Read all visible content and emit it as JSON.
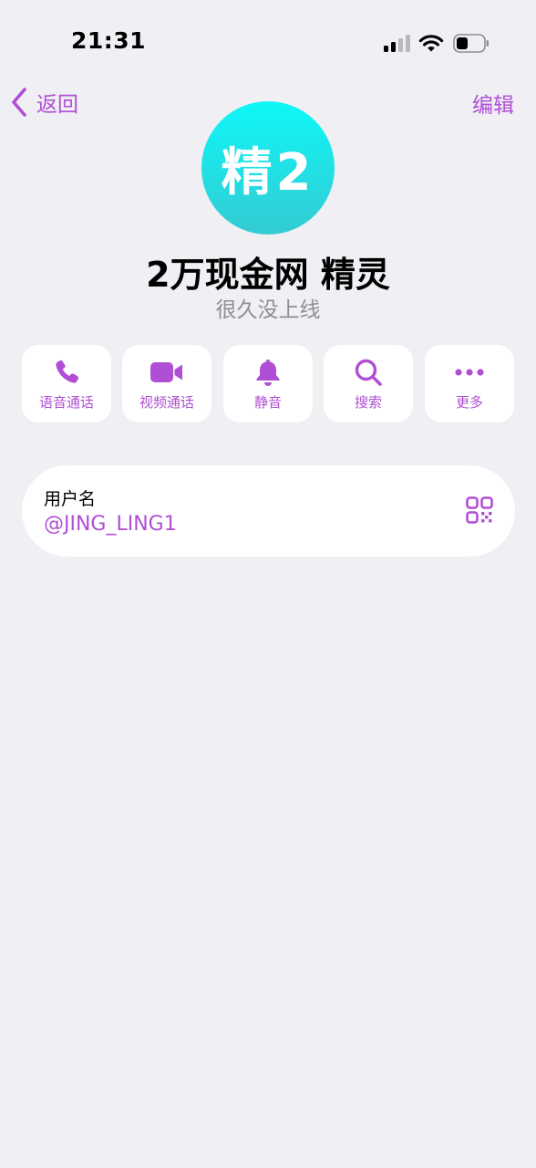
{
  "status_bar": {
    "time": "21:31"
  },
  "nav": {
    "back_label": "返回",
    "edit_label": "编辑"
  },
  "profile": {
    "avatar_text": "精2",
    "name": "2万现金网 精灵",
    "presence": "很久没上线"
  },
  "actions": [
    {
      "label": "语音通话",
      "icon": "phone-icon"
    },
    {
      "label": "视频通话",
      "icon": "video-icon"
    },
    {
      "label": "静音",
      "icon": "bell-icon"
    },
    {
      "label": "搜索",
      "icon": "search-icon"
    },
    {
      "label": "更多",
      "icon": "more-icon"
    }
  ],
  "info": {
    "username_label": "用户名",
    "username_value": "@JING_LING1"
  },
  "colors": {
    "accent": "#b04fd4",
    "background": "#efeff4",
    "avatar_top": "#0ef7f7",
    "avatar_bottom": "#34cbd3",
    "secondary_text": "#8e8e93"
  }
}
